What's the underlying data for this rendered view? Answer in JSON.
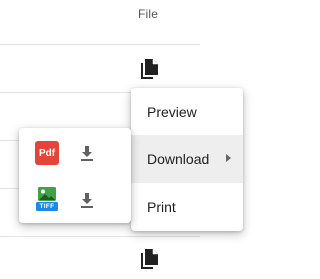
{
  "table": {
    "column_header": "File"
  },
  "context_menu": {
    "items": [
      {
        "label": "Preview"
      },
      {
        "label": "Download"
      },
      {
        "label": "Print"
      }
    ]
  },
  "download_submenu": {
    "formats": [
      {
        "format_label": "Pdf",
        "icon": "pdf-icon",
        "action_icon": "download-icon"
      },
      {
        "format_label": "TIFF",
        "icon": "tiff-image-icon",
        "action_icon": "download-icon"
      }
    ]
  },
  "colors": {
    "pdf_red": "#e4453a",
    "tiff_blue": "#1e88e5",
    "tiff_green": "#43a047",
    "icon_dark": "#212121",
    "icon_gray": "#616161",
    "menu_highlight": "#eeeeee"
  }
}
